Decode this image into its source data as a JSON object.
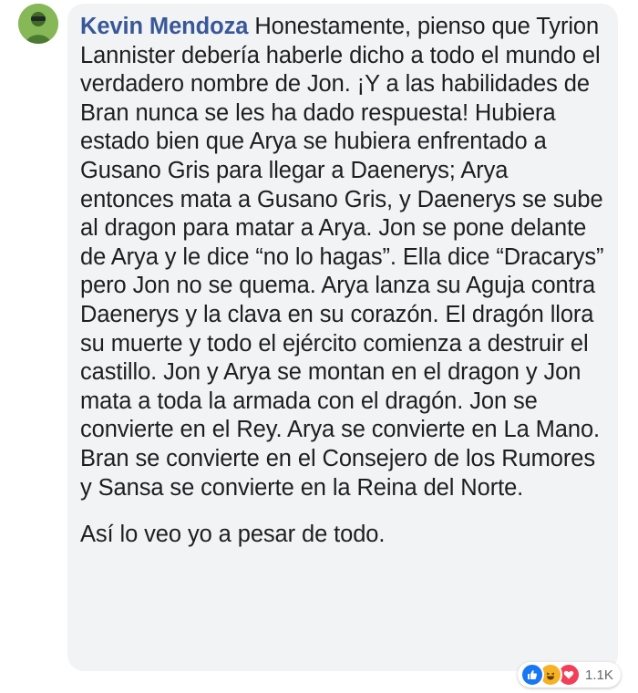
{
  "comment": {
    "author": "Kevin Mendoza",
    "paragraphs": [
      "Honestamente, pienso que Tyrion Lannister debería haberle dicho a todo el mundo el verdadero nombre de Jon. ¡Y a las habilidades de Bran nunca se les ha dado respuesta! Hubiera estado bien que Arya se hubiera enfrentado a Gusano Gris para llegar a Daenerys; Arya entonces mata a Gusano Gris, y Daenerys se sube al dragon para matar a Arya. Jon se pone delante de Arya y le dice “no lo hagas”. Ella dice “Dracarys” pero Jon no se quema. Arya lanza su Aguja contra Daenerys y la clava en su corazón. El dragón llora su muerte y todo el ejército comienza a destruir el castillo. Jon y Arya se montan en el dragon y Jon mata a toda la armada con el dragón. Jon se convierte en el Rey. Arya se convierte en La Mano. Bran se convierte en el Consejero de los Rumores y Sansa se convierte en la Reina del Norte.",
      "Así lo veo yo a pesar de todo."
    ]
  },
  "reactions": {
    "icons": [
      "like-icon",
      "haha-icon",
      "love-icon"
    ],
    "count": "1.1K"
  },
  "colors": {
    "author": "#385898",
    "bubble": "#f2f3f5",
    "like": "#1877f2",
    "haha": "#f7b125",
    "love": "#f33e58"
  }
}
